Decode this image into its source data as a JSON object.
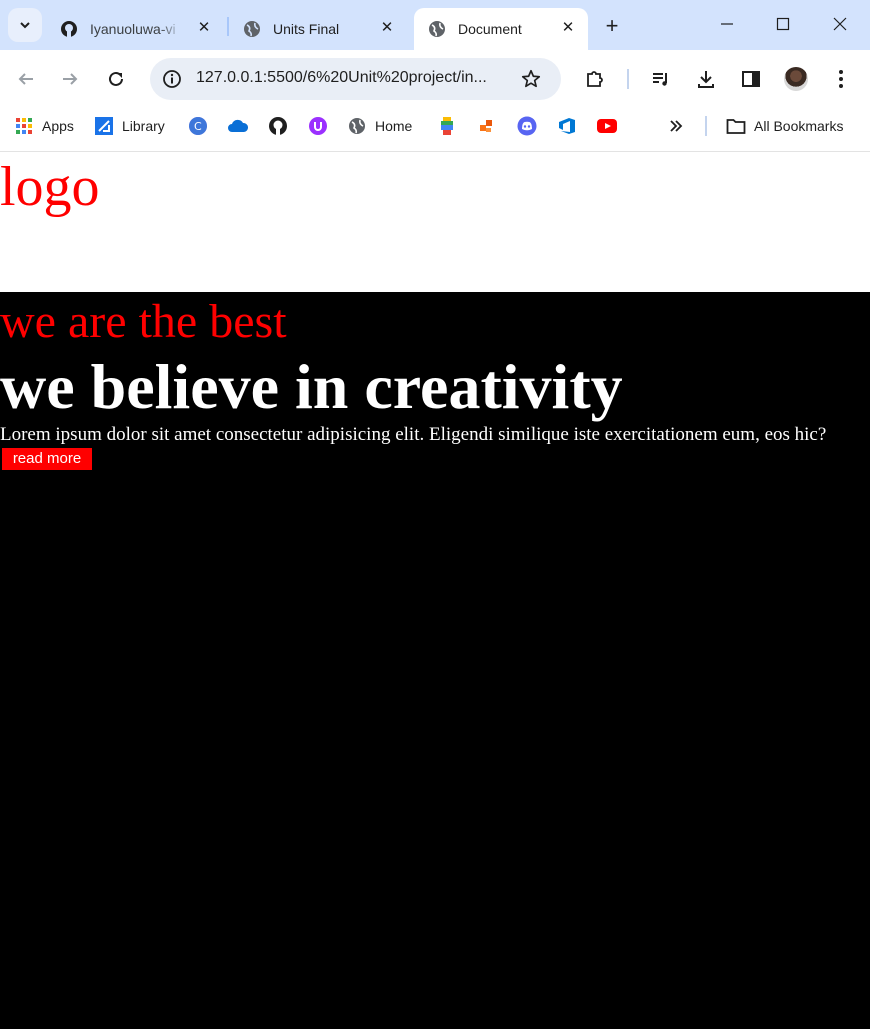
{
  "browser": {
    "tabs": [
      {
        "title": "Iyanuoluwa-vi",
        "favicon": "github-icon",
        "active": false
      },
      {
        "title": "Units Final",
        "favicon": "globe-icon",
        "active": false
      },
      {
        "title": "Document",
        "favicon": "globe-icon",
        "active": true
      }
    ],
    "address_bar": {
      "url": "127.0.0.1:5500/6%20Unit%20project/in..."
    },
    "bookmarks": [
      {
        "label": "Apps",
        "icon": "apps-grid-icon"
      },
      {
        "label": "Library",
        "icon": "library-icon"
      },
      {
        "label": "",
        "icon": "canva-icon"
      },
      {
        "label": "",
        "icon": "onedrive-cloud-icon"
      },
      {
        "label": "",
        "icon": "github-icon"
      },
      {
        "label": "",
        "icon": "purple-u-icon"
      },
      {
        "label": "Home",
        "icon": "globe-icon"
      },
      {
        "label": "",
        "icon": "colorful-app-icon"
      },
      {
        "label": "",
        "icon": "orange-app-icon"
      },
      {
        "label": "",
        "icon": "discord-icon"
      },
      {
        "label": "",
        "icon": "azure-devops-icon"
      },
      {
        "label": "",
        "icon": "youtube-icon"
      }
    ],
    "all_bookmarks_label": "All Bookmarks",
    "colors": {
      "tabstrip": "#d3e3fd",
      "omnibox": "#e9eef6"
    }
  },
  "page": {
    "logo": "logo",
    "tagline": "we are the best",
    "headline": "we believe in creativity",
    "paragraph": "Lorem ipsum dolor sit amet consectetur adipisicing elit. Eligendi similique iste exercitationem eum, eos hic?",
    "button_label": "read more",
    "colors": {
      "accent": "#ff0000",
      "hero_background": "#000000",
      "header_background": "#ffffff",
      "text": "#ffffff"
    }
  }
}
